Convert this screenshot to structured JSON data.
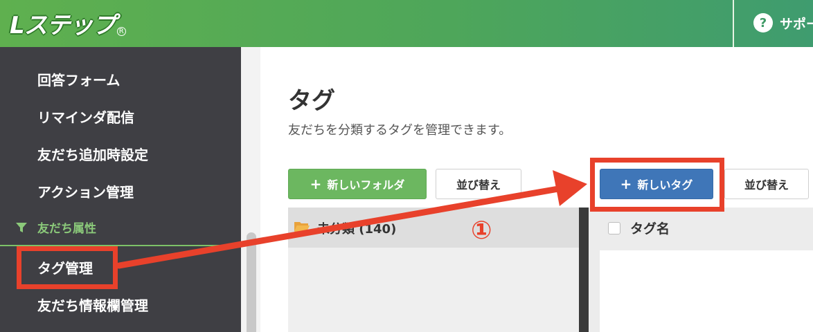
{
  "header": {
    "logo": "Lステップ",
    "support_label": "サポー",
    "help_icon": "?"
  },
  "sidebar": {
    "items": [
      {
        "label": "回答フォーム"
      },
      {
        "label": "リマインダ配信"
      },
      {
        "label": "友だち追加時設定"
      },
      {
        "label": "アクション管理"
      }
    ],
    "section": {
      "label": "友だち属性",
      "icon": "filter-icon"
    },
    "active_item": "タグ管理",
    "after_items": [
      {
        "label": "友だち情報欄管理"
      }
    ]
  },
  "main": {
    "title": "タグ",
    "description": "友だちを分類するタグを管理できます。",
    "buttons": {
      "new_folder": "新しいフォルダ",
      "sort_left": "並び替え",
      "new_tag": "新しいタグ",
      "sort_right": "並び替え"
    },
    "folder_panel": {
      "label": "未分類 (140)"
    },
    "tag_table": {
      "column": "タグ名"
    }
  },
  "annotation": {
    "step": "①",
    "color": "#e8412b"
  },
  "colors": {
    "header_green": "#5fb04f",
    "sidebar_bg": "#3f3f44",
    "btn_green": "#6cb760",
    "btn_blue": "#3f76b8",
    "highlight_red": "#e8412b"
  }
}
